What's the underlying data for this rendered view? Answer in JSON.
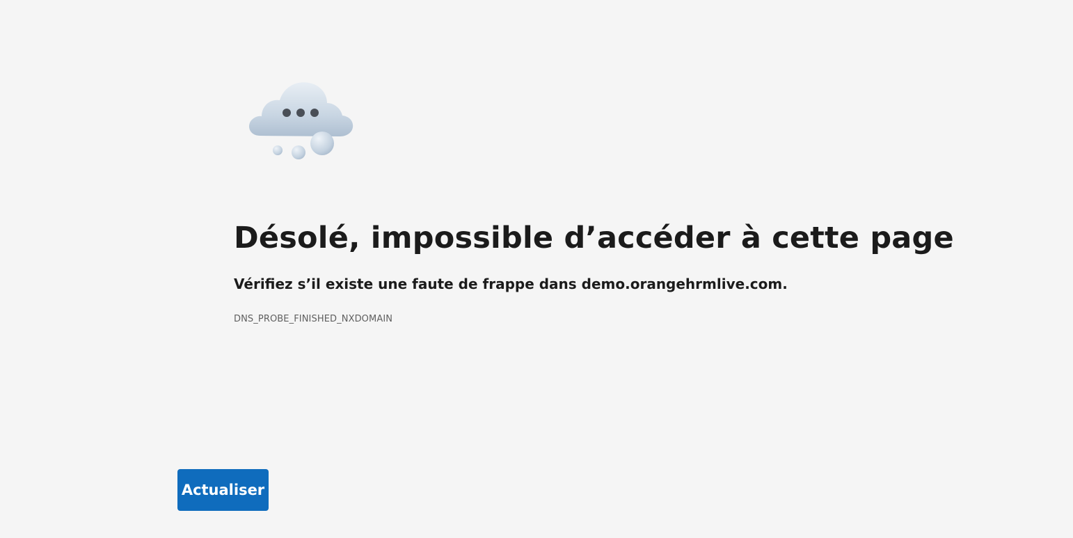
{
  "illustration": {
    "icon": "cloud-thinking-icon"
  },
  "error": {
    "title": "Désolé, impossible d’accéder à cette page",
    "subtitle": "Vérifiez s’il existe une faute de frappe dans demo.orangehrmlive.com.",
    "code": "DNS_PROBE_FINISHED_NXDOMAIN"
  },
  "actions": {
    "refresh_label": "Actualiser"
  },
  "colors": {
    "background": "#f5f5f5",
    "button": "#0f6cbd",
    "button_text": "#ffffff"
  }
}
